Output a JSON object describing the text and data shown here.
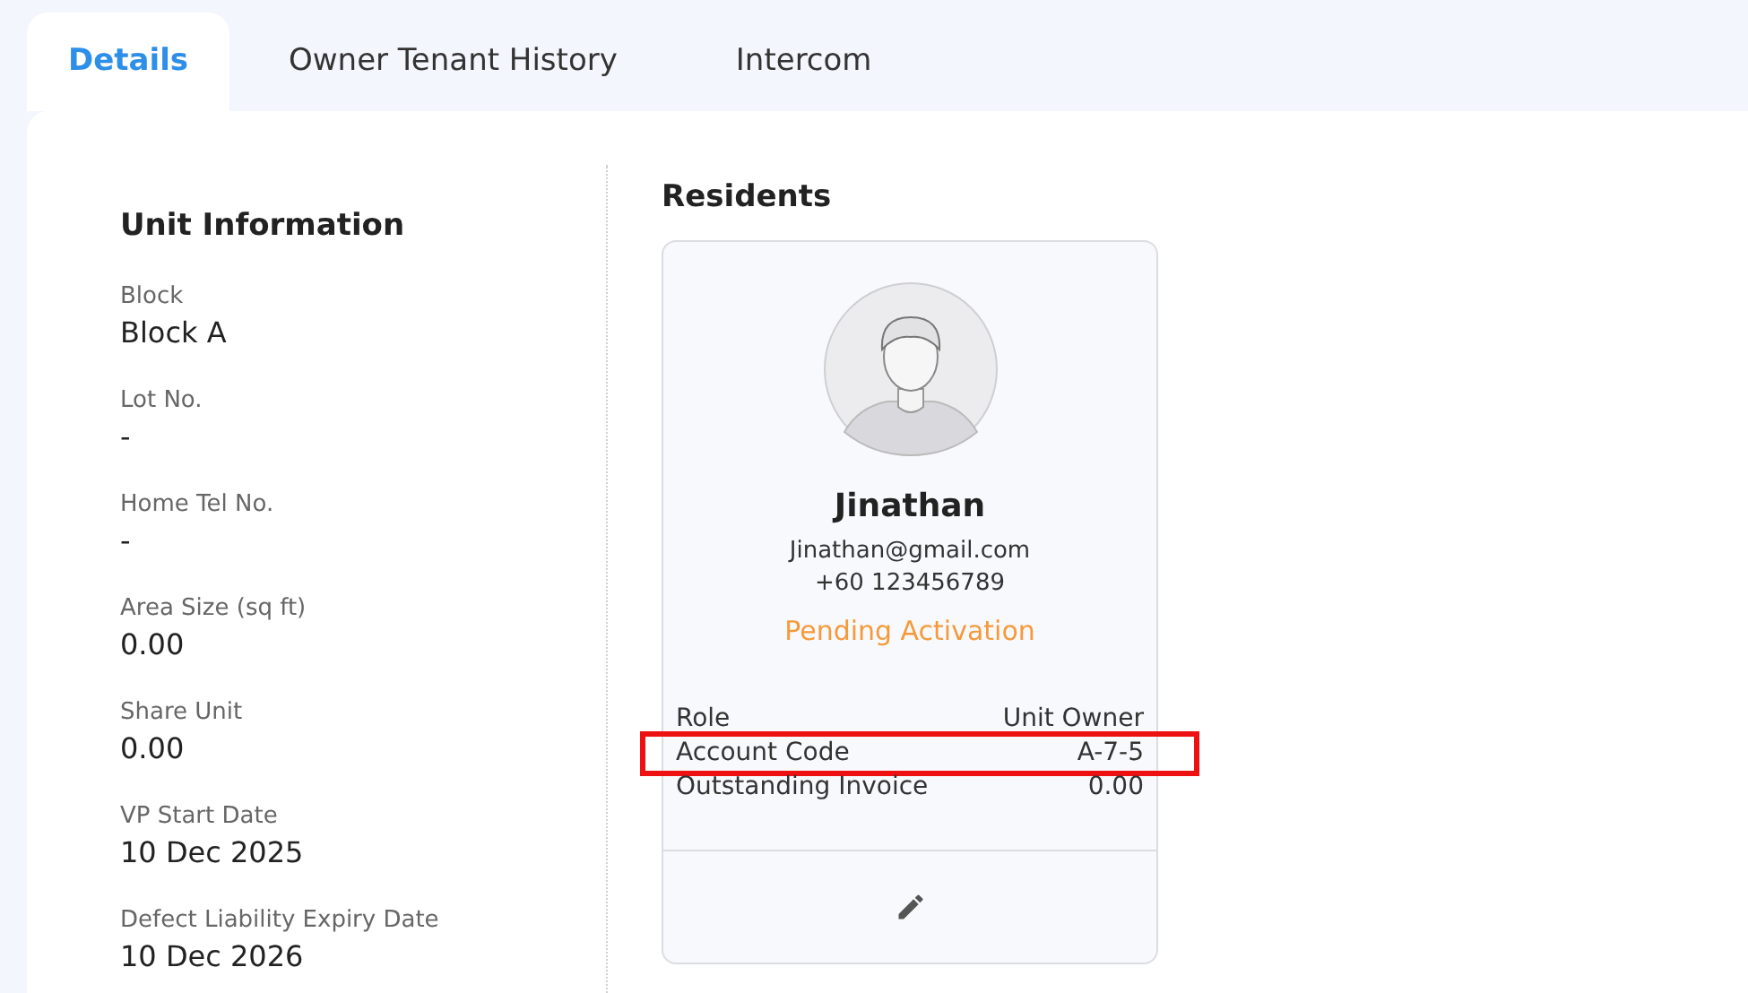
{
  "tabs": [
    {
      "label": "Details",
      "selected": true
    },
    {
      "label": "Owner Tenant History",
      "selected": false
    },
    {
      "label": "Intercom",
      "selected": false
    }
  ],
  "unit_information": {
    "title": "Unit Information",
    "fields": [
      {
        "label": "Block",
        "value": "Block A"
      },
      {
        "label": "Lot No.",
        "value": "-"
      },
      {
        "label": "Home Tel No.",
        "value": "-"
      },
      {
        "label": "Area Size (sq ft)",
        "value": "0.00"
      },
      {
        "label": "Share Unit",
        "value": "0.00"
      },
      {
        "label": "VP Start Date",
        "value": "10 Dec 2025"
      },
      {
        "label": "Defect Liability Expiry Date",
        "value": "10 Dec 2026"
      }
    ]
  },
  "residents": {
    "title": "Residents",
    "cards": [
      {
        "name": "Jinathan",
        "email": "Jinathan@gmail.com",
        "phone": "+60 123456789",
        "status": "Pending Activation",
        "details": [
          {
            "label": "Role",
            "value": "Unit Owner",
            "highlighted": false
          },
          {
            "label": "Account Code",
            "value": "A-7-5",
            "highlighted": true
          },
          {
            "label": "Outstanding Invoice",
            "value": "0.00",
            "highlighted": false
          }
        ]
      }
    ]
  }
}
